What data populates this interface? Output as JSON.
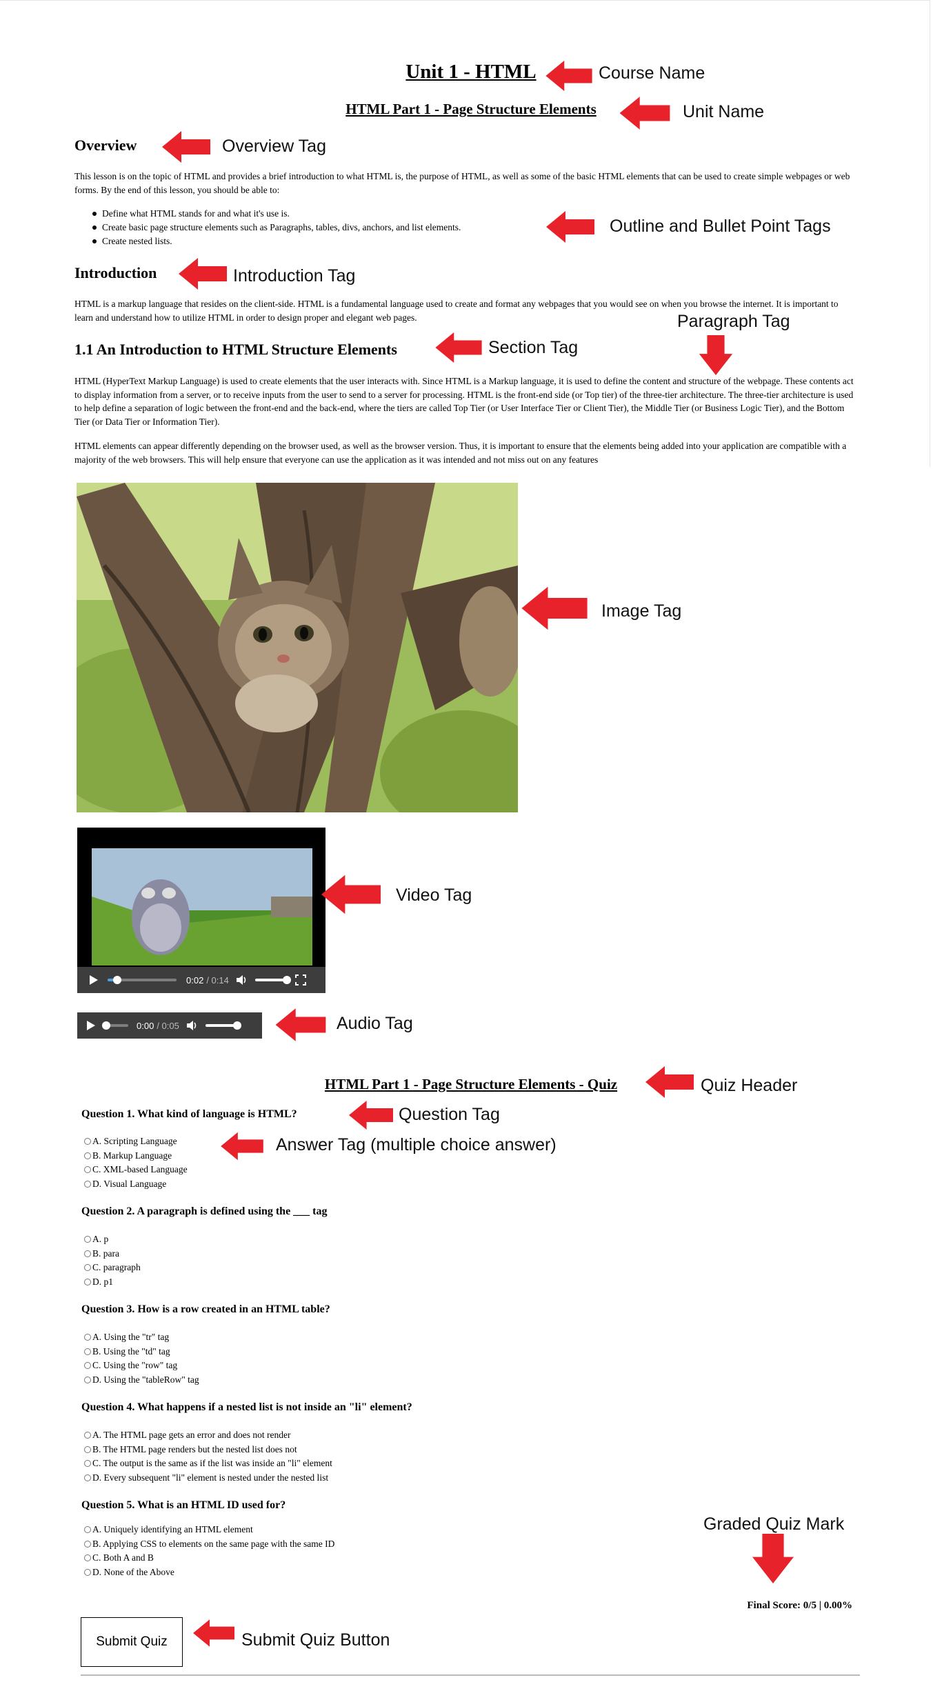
{
  "lesson": {
    "course_title": "Unit 1 - HTML",
    "unit_title": "HTML Part 1 - Page Structure Elements",
    "overview_heading": "Overview",
    "overview_text": "This lesson is on the topic of HTML and provides a brief introduction to what HTML is, the purpose of HTML, as well as some of the basic HTML elements that can be used to create simple webpages or web forms. By the end of this lesson, you should be able to:",
    "bullets": [
      "Define what HTML stands for and what it's use is.",
      "Create basic page structure elements such as Paragraphs, tables, divs, anchors, and list elements.",
      "Create nested lists."
    ],
    "intro_heading": "Introduction",
    "intro_text": "HTML is a markup language that resides on the client-side. HTML is a fundamental language used to create and format any webpages that you would see on when you browse the internet. It is important to learn and understand how to utilize HTML in order to design proper and elegant web pages.",
    "section_heading": "1.1 An Introduction to HTML Structure Elements",
    "section_p1": "HTML (HyperText Markup Language) is used to create elements that the user interacts with. Since HTML is a Markup language, it is used to define the content and structure of the webpage. These contents act to display information from a server, or to receive inputs from the user to send to a server for processing. HTML is the front-end side (or Top tier) of the three-tier architecture. The three-tier architecture is used to help define a separation of logic between the front-end and the back-end, where the tiers are called Top Tier (or User Interface Tier or Client Tier), the Middle Tier (or Business Logic Tier), and the Bottom Tier (or Data Tier or Information Tier).",
    "section_p2": "HTML elements can appear differently depending on the browser used, as well as the browser version. Thus, it is important to ensure that the elements being added into your application are compatible with a majority of the web browsers. This will help ensure that everyone can use the application as it was intended and not miss out on any features"
  },
  "media": {
    "video_time": "0:02",
    "video_duration": "/ 0:14",
    "video_progress": 0.14,
    "audio_time": "0:00",
    "audio_duration": "/ 0:05",
    "audio_progress": 0.0
  },
  "quiz": {
    "header": "HTML Part 1 - Page Structure Elements - Quiz",
    "questions": [
      {
        "text": "Question 1. What kind of language is HTML?",
        "options": [
          "A. Scripting Language",
          "B. Markup Language",
          "C. XML-based Language",
          "D. Visual Language"
        ]
      },
      {
        "text": "Question 2. A paragraph is defined using the ___ tag",
        "options": [
          "A. p",
          "B. para",
          "C. paragraph",
          "D. p1"
        ]
      },
      {
        "text": "Question 3. How is a row created in an HTML table?",
        "options": [
          "A. Using the \"tr\" tag",
          "B. Using the \"td\" tag",
          "C. Using the \"row\" tag",
          "D. Using the \"tableRow\" tag"
        ]
      },
      {
        "text": "Question 4. What happens if a nested list is not inside an \"li\" element?",
        "options": [
          "A. The HTML page gets an error and does not render",
          "B. The HTML page renders but the nested list does not",
          "C. The output is the same as if the list was inside an \"li\" element",
          "D. Every subsequent \"li\" element is nested under the nested list"
        ]
      },
      {
        "text": "Question 5. What is an HTML ID used for?",
        "options": [
          "A. Uniquely identifying an HTML element",
          "B. Applying CSS to elements on the same page with the same ID",
          "C. Both A and B",
          "D. None of the Above"
        ]
      }
    ],
    "final_score": "Final Score: 0/5 | 0.00%",
    "submit_label": "Submit Quiz"
  },
  "annotations": {
    "course_name": "Course Name",
    "unit_name": "Unit Name",
    "overview_tag": "Overview Tag",
    "outline_tags": "Outline and Bullet Point Tags",
    "introduction_tag": "Introduction Tag",
    "paragraph_tag": "Paragraph Tag",
    "section_tag": "Section Tag",
    "image_tag": "Image Tag",
    "video_tag": "Video Tag",
    "audio_tag": "Audio Tag",
    "quiz_header": "Quiz Header",
    "question_tag": "Question Tag",
    "answer_tag": "Answer Tag (multiple choice answer)",
    "graded_quiz_mark": "Graded Quiz Mark",
    "submit_quiz_button": "Submit Quiz Button"
  },
  "colors": {
    "arrow": "#e8222a",
    "player_bar": "#3d3d3d",
    "progress": "#4aa0e8"
  }
}
